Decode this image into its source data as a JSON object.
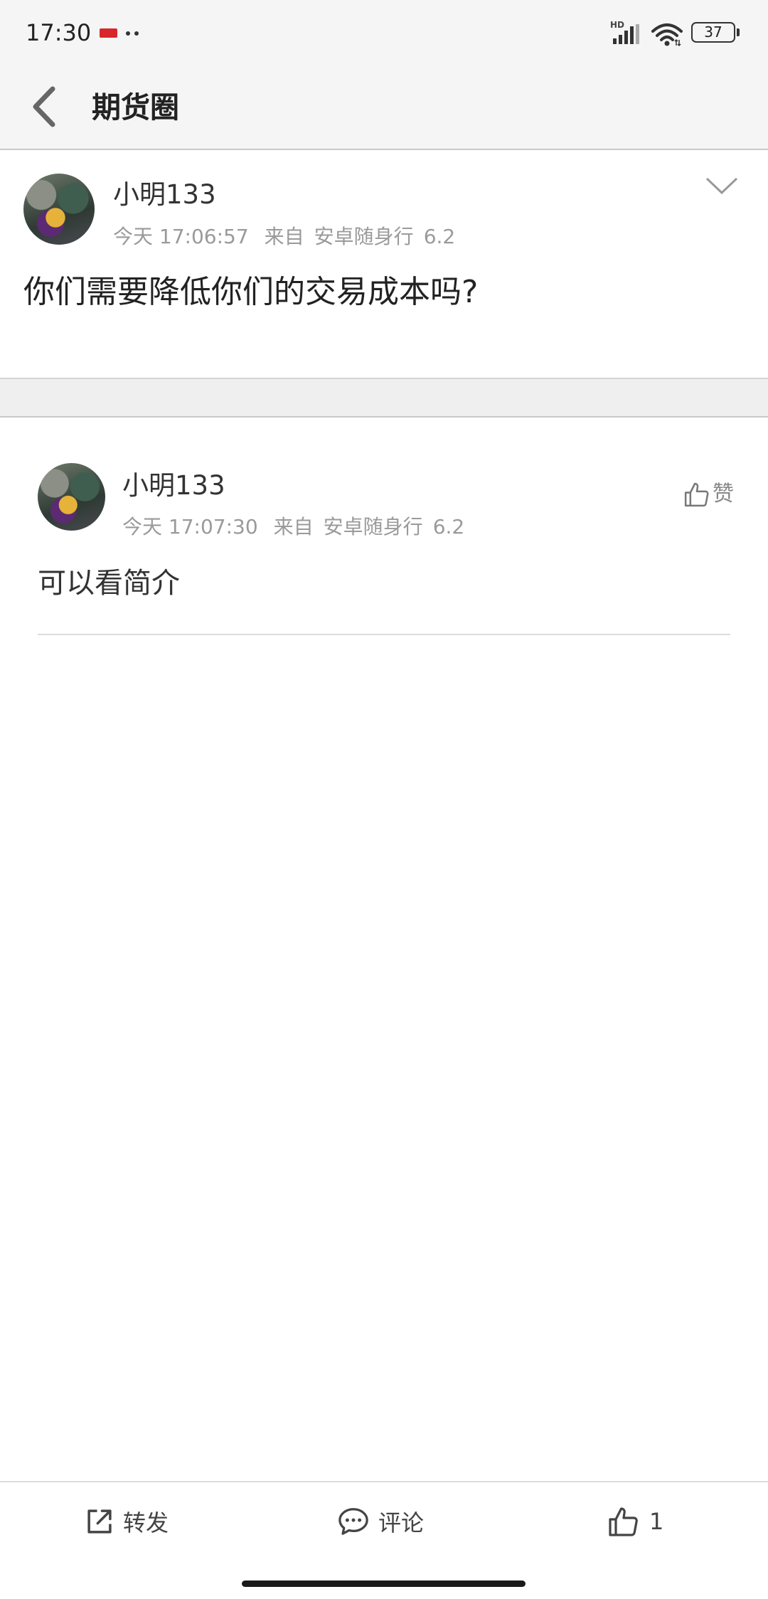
{
  "status_bar": {
    "time": "17:30",
    "network_label": "HD",
    "battery": "37",
    "icons": [
      "notification-flag-icon",
      "signal-icon",
      "wifi-icon",
      "battery-icon"
    ]
  },
  "header": {
    "title": "期货圈",
    "back_icon": "chevron-left-icon"
  },
  "post": {
    "author": "小明133",
    "time": "今天 17:06:57",
    "source_prefix": "来自",
    "source": "安卓随身行",
    "version": "6.2",
    "content": "你们需要降低你们的交易成本吗?",
    "menu_icon": "chevron-down-icon"
  },
  "comments": [
    {
      "author": "小明133",
      "time": "今天 17:07:30",
      "source_prefix": "来自",
      "source": "安卓随身行",
      "version": "6.2",
      "content": "可以看简介",
      "like_label": "赞",
      "like_icon": "thumbs-up-icon"
    }
  ],
  "bottom_bar": {
    "share_label": "转发",
    "share_icon": "share-icon",
    "comment_label": "评论",
    "comment_icon": "comment-icon",
    "like_count": "1",
    "like_icon": "thumbs-up-icon"
  },
  "colors": {
    "header_bg": "#f5f5f5",
    "separator_bg": "#efefef",
    "meta_text": "#9a9a9a",
    "primary_text": "#222222",
    "notification_flag": "#d8262b"
  }
}
